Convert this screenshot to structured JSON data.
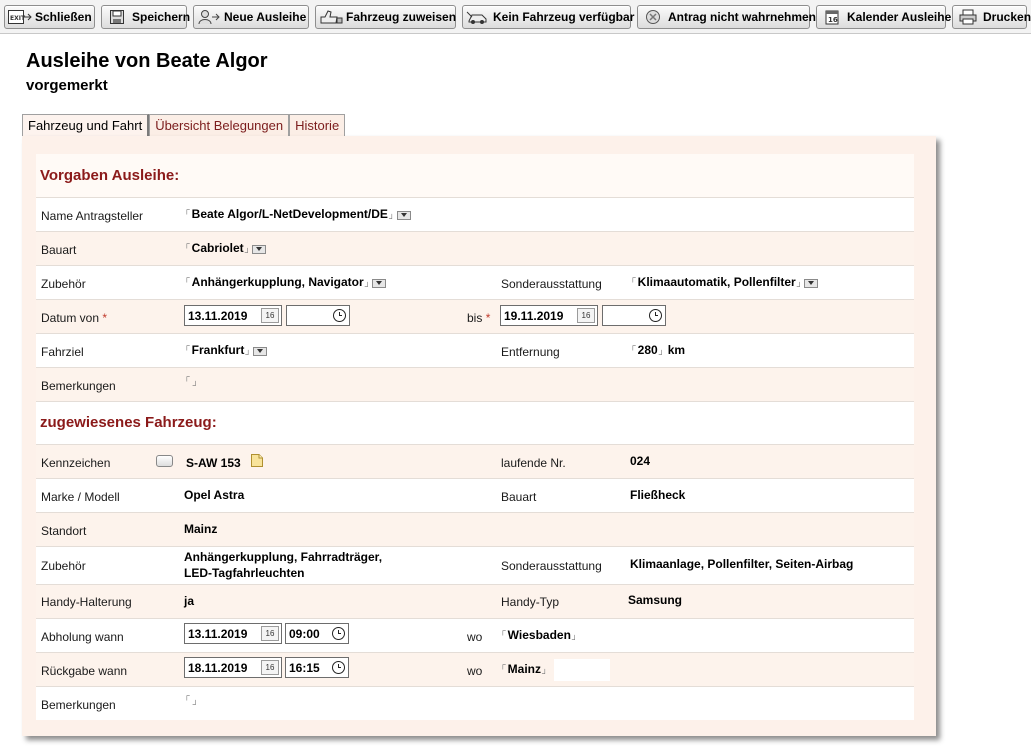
{
  "toolbar": {
    "buttons": [
      {
        "label": "Schließen",
        "icon": "exit-icon"
      },
      {
        "label": "Speichern",
        "icon": "save-icon"
      },
      {
        "label": "Neue Ausleihe",
        "icon": "new-loan-icon"
      },
      {
        "label": "Fahrzeug zuweisen",
        "icon": "assign-vehicle-icon"
      },
      {
        "label": "Kein Fahrzeug verfügbar",
        "icon": "no-vehicle-icon"
      },
      {
        "label": "Antrag nicht wahrnehmen",
        "icon": "decline-icon"
      },
      {
        "label": "Kalender Ausleihe",
        "icon": "calendar-icon"
      },
      {
        "label": "Drucken",
        "icon": "print-icon"
      }
    ]
  },
  "header": {
    "title": "Ausleihe von Beate Algor",
    "status": "vorgemerkt"
  },
  "tabs": [
    {
      "label": "Fahrzeug und Fahrt",
      "active": true
    },
    {
      "label": "Übersicht Belegungen",
      "active": false
    },
    {
      "label": "Historie",
      "active": false
    }
  ],
  "request": {
    "section_title": "Vorgaben Ausleihe:",
    "applicant_label": "Name Antragsteller",
    "applicant_value": "Beate Algor/L-NetDevelopment/DE",
    "type_label": "Bauart",
    "type_value": "Cabriolet",
    "accessories_label": "Zubehör",
    "accessories_value": "Anhängerkupplung, Navigator",
    "special_label": "Sonderausstattung",
    "special_value": "Klimaautomatik, Pollenfilter",
    "date_from_label": "Datum von",
    "date_from_value": "13.11.2019",
    "time_from_value": "",
    "date_to_label": "bis",
    "date_to_value": "19.11.2019",
    "time_to_value": "",
    "required_mark": "*",
    "destination_label": "Fahrziel",
    "destination_value": "Frankfurt",
    "distance_label": "Entfernung",
    "distance_value": "280",
    "distance_unit": "km",
    "remarks_label": "Bemerkungen",
    "remarks_value": ""
  },
  "vehicle": {
    "section_title": "zugewiesenes Fahrzeug:",
    "plate_label": "Kennzeichen",
    "plate_value": "S-AW 153",
    "number_label": "laufende Nr.",
    "number_value": "024",
    "model_label": "Marke / Modell",
    "model_value": "Opel Astra",
    "type_label": "Bauart",
    "type_value": "Fließheck",
    "location_label": "Standort",
    "location_value": "Mainz",
    "accessories_label": "Zubehör",
    "accessories_line1": "Anhängerkupplung, Fahrradträger,",
    "accessories_line2": "LED-Tagfahrleuchten",
    "special_label": "Sonderausstattung",
    "special_value": "Klimaanlage, Pollenfilter, Seiten-Airbag",
    "phone_holder_label": "Handy-Halterung",
    "phone_holder_value": "ja",
    "phone_type_label": "Handy-Typ",
    "phone_type_value": "Samsung",
    "pickup_label": "Abholung wann",
    "pickup_date": "13.11.2019",
    "pickup_time": "09:00",
    "pickup_where_label": "wo",
    "pickup_where_value": "Wiesbaden",
    "return_label": "Rückgabe wann",
    "return_date": "18.11.2019",
    "return_time": "16:15",
    "return_where_label": "wo",
    "return_where_value": "Mainz",
    "remarks_label": "Bemerkungen",
    "remarks_value": ""
  },
  "calendar_button_text": "16"
}
